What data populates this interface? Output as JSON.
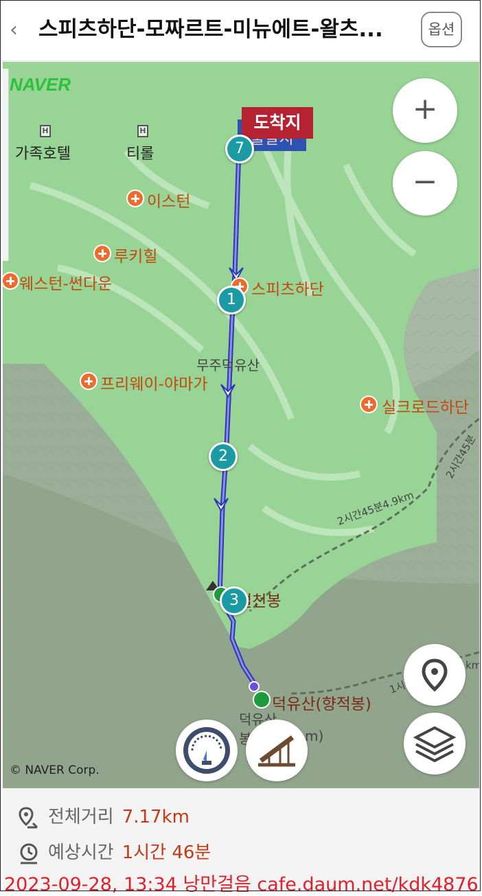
{
  "header": {
    "back_icon": "chevron-left-icon",
    "title": "스피츠하단-모짜르트-미뉴에트-왈츠...",
    "options_label": "옵션"
  },
  "map": {
    "logo": "NAVER",
    "copyright": "© NAVER Corp.",
    "hotels": [
      {
        "name": "가족호텔",
        "icon": "hotel-icon"
      },
      {
        "name": "티롤",
        "icon": "hotel-icon"
      }
    ],
    "pois": [
      {
        "name": "이스턴"
      },
      {
        "name": "루키힐"
      },
      {
        "name": "웨스턴-썬다운"
      },
      {
        "name": "스피츠하단"
      },
      {
        "name": "프리웨이-야마가"
      },
      {
        "name": "실크로드하단"
      },
      {
        "name": "설천봉"
      },
      {
        "name": "덕유산(향적봉)"
      }
    ],
    "resort_label": "무주덕유산",
    "trail_label": "2시간45분4.9km",
    "trail_label_2": "2시간45분",
    "peak_label_partial": "덕유산",
    "peak_label_partial_2": "봉",
    "peak_label_partial_3": "m)",
    "trail_label_3": "1시",
    "trail_label_4": "km",
    "destination_label": "도착지",
    "start_label": "출발지",
    "pins": [
      "7",
      "1",
      "2",
      "3"
    ],
    "zoom_in": "+",
    "zoom_out": "−",
    "controls": [
      "location-icon",
      "layers-icon",
      "speedometer-icon",
      "slope-icon"
    ]
  },
  "summary": {
    "distance_label": "전체거리",
    "distance_value": "7.17km",
    "time_label": "예상시간",
    "time_value": "1시간 46분"
  },
  "watermark": "2023-09-28, 13:34 낭만걸음 cafe.daum.net/kdk4876",
  "colors": {
    "route": "#2d37b8",
    "pin": "#1a9aa3",
    "resort_area": "#98d495",
    "poi": "#f06a2c",
    "value_text": "#c23a16"
  }
}
